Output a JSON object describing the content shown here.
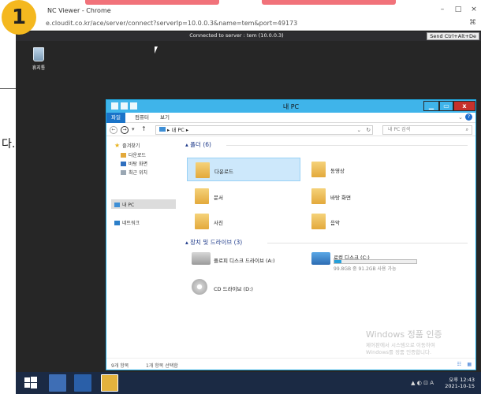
{
  "badge_number": "1",
  "underlying_page": {
    "fragment_text": "다."
  },
  "browser": {
    "title": "NC Viewer - Chrome",
    "url": "e.cloudit.co.kr/ace/server/connect?serverIp=10.0.0.3&name=tem&port=49173",
    "controls": {
      "minimize": "–",
      "maximize": "□",
      "close": "×"
    },
    "extension_icon": "⌘"
  },
  "vnc": {
    "status": "Connected to server : tem (10.0.0.3)",
    "ctrl_alt_del": "Send Ctrl+Alt+De"
  },
  "desktop": {
    "recycle_bin_label": "휴지통"
  },
  "explorer": {
    "title": "내 PC",
    "ribbon_tabs": [
      "파일",
      "컴퓨터",
      "보기"
    ],
    "path": "▸ 내 PC ▸",
    "search_placeholder": "내 PC 검색",
    "nav_items": [
      {
        "label": "즐겨찾기",
        "icon": "star-icon"
      },
      {
        "label": "다운로드",
        "icon": "download-folder-icon"
      },
      {
        "label": "바탕 화면",
        "icon": "desktop-icon"
      },
      {
        "label": "최근 위치",
        "icon": "recent-icon"
      },
      {
        "label": "내 PC",
        "icon": "computer-icon"
      },
      {
        "label": "네트워크",
        "icon": "network-icon"
      }
    ],
    "folders_header": "폴더 (6)",
    "folders": [
      "다운로드",
      "동영상",
      "문서",
      "바탕 화면",
      "사진",
      "음악"
    ],
    "drives_header": "장치 및 드라이브 (3)",
    "drives": [
      {
        "name": "플로피 디스크 드라이브 (A:)"
      },
      {
        "name": "로컬 디스크 (C:)",
        "usage": "99.8GB 중 91.2GB 사용 가능",
        "used_fraction": 0.086
      },
      {
        "name": "CD 드라이브 (D:)"
      }
    ],
    "status_count": "9개 항목",
    "status_selected": "1개 항목 선택함"
  },
  "watermark": {
    "line1": "Windows 정품 인증",
    "line2": "제어판에서 시스템으로 이동하여",
    "line3": "Windows를 정품 인증합니다."
  },
  "taskbar": {
    "tray": "▲ ◐ ⊡ A",
    "time": "오후 12:43",
    "date": "2021-10-15"
  }
}
